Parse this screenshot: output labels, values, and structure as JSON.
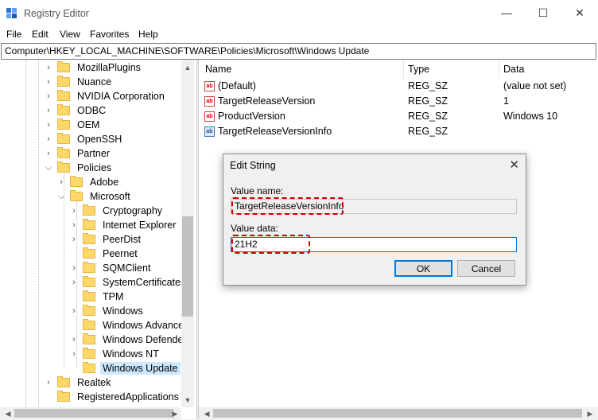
{
  "window": {
    "title": "Registry Editor",
    "controls": {
      "minimize": "—",
      "maximize": "☐",
      "close": "✕"
    }
  },
  "menu": [
    "File",
    "Edit",
    "View",
    "Favorites",
    "Help"
  ],
  "address": "Computer\\HKEY_LOCAL_MACHINE\\SOFTWARE\\Policies\\Microsoft\\Windows Update",
  "tree": [
    {
      "label": "MozillaPlugins",
      "expandable": true
    },
    {
      "label": "Nuance",
      "expandable": true
    },
    {
      "label": "NVIDIA Corporation",
      "expandable": true
    },
    {
      "label": "ODBC",
      "expandable": true
    },
    {
      "label": "OEM",
      "expandable": true
    },
    {
      "label": "OpenSSH",
      "expandable": true
    },
    {
      "label": "Partner",
      "expandable": true
    },
    {
      "label": "Policies",
      "expanded": true
    },
    {
      "label": "Adobe",
      "expandable": true
    },
    {
      "label": "Microsoft",
      "expanded": true
    },
    {
      "label": "Cryptography",
      "expandable": true
    },
    {
      "label": "Internet Explorer",
      "expandable": true
    },
    {
      "label": "PeerDist",
      "expandable": true
    },
    {
      "label": "Peernet",
      "expandable": false
    },
    {
      "label": "SQMClient",
      "expandable": true
    },
    {
      "label": "SystemCertificates",
      "expandable": true
    },
    {
      "label": "TPM",
      "expandable": false
    },
    {
      "label": "Windows",
      "expandable": true
    },
    {
      "label": "Windows Advanced",
      "expandable": false
    },
    {
      "label": "Windows Defender",
      "expandable": true
    },
    {
      "label": "Windows NT",
      "expandable": true
    },
    {
      "label": "Windows Update",
      "expandable": false,
      "selected": true
    },
    {
      "label": "Realtek",
      "expandable": true
    },
    {
      "label": "RegisteredApplications",
      "expandable": false
    }
  ],
  "columns": {
    "name": "Name",
    "type": "Type",
    "data": "Data"
  },
  "values": [
    {
      "name": "(Default)",
      "type": "REG_SZ",
      "data": "(value not set)",
      "icon": "ab"
    },
    {
      "name": "TargetReleaseVersion",
      "type": "REG_SZ",
      "data": "1",
      "icon": "ab"
    },
    {
      "name": "ProductVersion",
      "type": "REG_SZ",
      "data": "Windows 10",
      "icon": "ab"
    },
    {
      "name": "TargetReleaseVersionInfo",
      "type": "REG_SZ",
      "data": "",
      "icon": "ab"
    }
  ],
  "dialog": {
    "title": "Edit String",
    "close": "✕",
    "value_name_label": "Value name:",
    "value_name": "TargetReleaseVersionInfo",
    "value_data_label": "Value data:",
    "value_data": "21H2",
    "ok": "OK",
    "cancel": "Cancel"
  },
  "colors": {
    "highlight": "#cc0000",
    "selection": "#cce8ff",
    "accent": "#0078d7"
  }
}
